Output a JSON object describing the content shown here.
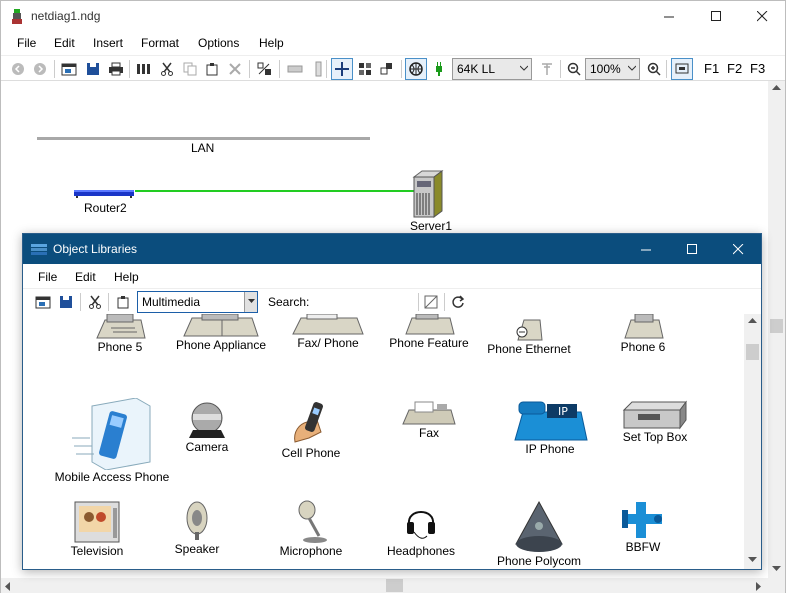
{
  "window": {
    "title": "netdiag1.ndg"
  },
  "menu": [
    "File",
    "Edit",
    "Insert",
    "Format",
    "Options",
    "Help"
  ],
  "toolbar": {
    "speed": "64K LL",
    "zoom": "100%",
    "fkeys": [
      "F1",
      "F2",
      "F3"
    ]
  },
  "canvas": {
    "lan_label": "LAN",
    "router_label": "Router2",
    "server_label": "Server1"
  },
  "dialog": {
    "title": "Object Libraries",
    "menu": [
      "File",
      "Edit",
      "Help"
    ],
    "library": "Multimedia",
    "search_label": "Search:",
    "search_value": "",
    "items": [
      {
        "label": "Phone 5",
        "icon": "phone-icon"
      },
      {
        "label": "Phone Appliance",
        "icon": "phone-appliance-icon"
      },
      {
        "label": "Fax/ Phone",
        "icon": "fax-phone-icon"
      },
      {
        "label": "Phone Feature",
        "icon": "phone-feature-icon"
      },
      {
        "label": "Phone Ethernet",
        "icon": "phone-ethernet-icon"
      },
      {
        "label": "Phone 6",
        "icon": "phone-icon"
      },
      {
        "label": "Mobile Access Phone",
        "icon": "mobile-phone-icon"
      },
      {
        "label": "Camera",
        "icon": "camera-icon"
      },
      {
        "label": "Cell Phone",
        "icon": "cell-phone-icon"
      },
      {
        "label": "Fax",
        "icon": "fax-icon"
      },
      {
        "label": "IP Phone",
        "icon": "ip-phone-icon"
      },
      {
        "label": "Set Top Box",
        "icon": "set-top-box-icon"
      },
      {
        "label": "Television",
        "icon": "television-icon"
      },
      {
        "label": "Speaker",
        "icon": "speaker-icon"
      },
      {
        "label": "Microphone",
        "icon": "microphone-icon"
      },
      {
        "label": "Headphones",
        "icon": "headphones-icon"
      },
      {
        "label": "Phone Polycom",
        "icon": "polycom-icon"
      },
      {
        "label": "BBFW",
        "icon": "bbfw-icon"
      }
    ],
    "ip_badge": "IP"
  },
  "colors": {
    "dialog_title": "#0b4d7d",
    "link_green": "#22cc22",
    "router_blue": "#1a35c8",
    "ip_phone_blue": "#1b8fd6"
  }
}
